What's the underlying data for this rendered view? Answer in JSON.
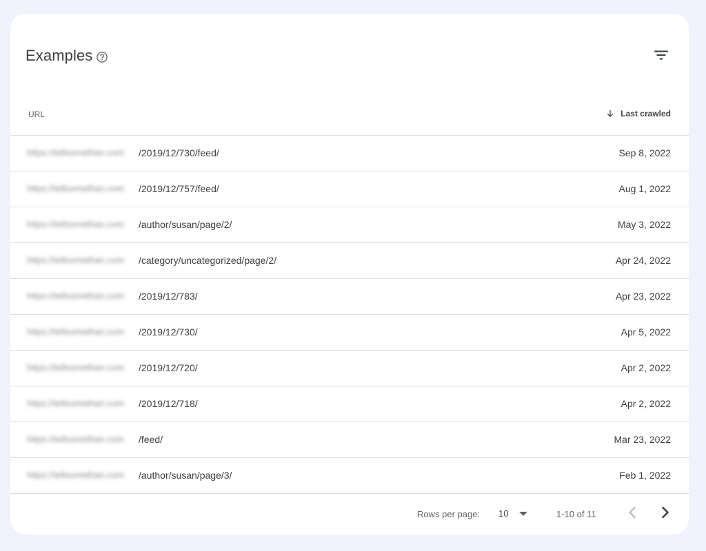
{
  "card": {
    "title": "Examples"
  },
  "icons": {
    "help": "help-circle-icon",
    "filter": "filter-list-icon",
    "sort": "arrow-down-icon",
    "dropdown": "dropdown-triangle-icon",
    "prev": "chevron-left-icon",
    "next": "chevron-right-icon"
  },
  "table": {
    "columns": {
      "url": "URL",
      "last_crawled": "Last crawled"
    },
    "sort": {
      "column": "last_crawled",
      "direction": "descending"
    },
    "rows": [
      {
        "host": "https://tellsomethan.com",
        "path": "/2019/12/730/feed/",
        "date": "Sep 8, 2022"
      },
      {
        "host": "https://tellsomethan.com",
        "path": "/2019/12/757/feed/",
        "date": "Aug 1, 2022"
      },
      {
        "host": "https://tellsomethan.com",
        "path": "/author/susan/page/2/",
        "date": "May 3, 2022"
      },
      {
        "host": "https://tellsomethan.com",
        "path": "/category/uncategorized/page/2/",
        "date": "Apr 24, 2022"
      },
      {
        "host": "https://tellsomethan.com",
        "path": "/2019/12/783/",
        "date": "Apr 23, 2022"
      },
      {
        "host": "https://tellsomethan.com",
        "path": "/2019/12/730/",
        "date": "Apr 5, 2022"
      },
      {
        "host": "https://tellsomethan.com",
        "path": "/2019/12/720/",
        "date": "Apr 2, 2022"
      },
      {
        "host": "https://tellsomethan.com",
        "path": "/2019/12/718/",
        "date": "Apr 2, 2022"
      },
      {
        "host": "https://tellsomethan.com",
        "path": "/feed/",
        "date": "Mar 23, 2022"
      },
      {
        "host": "https://tellsomethan.com",
        "path": "/author/susan/page/3/",
        "date": "Feb 1, 2022"
      }
    ]
  },
  "pagination": {
    "rows_per_page_label": "Rows per page:",
    "rows_per_page_value": "10",
    "range_label": "1-10 of 11"
  },
  "colors": {
    "page_background": "#f0f3fb",
    "card_background": "#ffffff",
    "divider": "#dadce0",
    "text_primary": "#3c4043",
    "text_secondary": "#5f6368",
    "icon_disabled": "#bdc1c6"
  }
}
